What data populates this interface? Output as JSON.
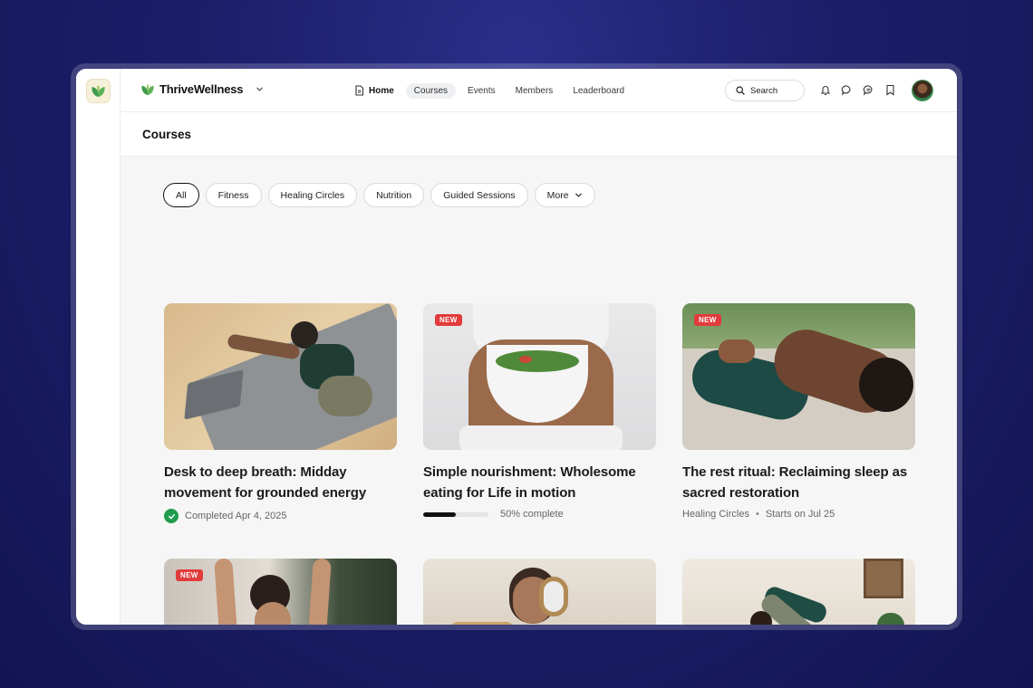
{
  "brand": {
    "name": "ThriveWellness"
  },
  "nav": {
    "home": "Home",
    "courses": "Courses",
    "events": "Events",
    "members": "Members",
    "leaderboard": "Leaderboard"
  },
  "search": {
    "label": "Search"
  },
  "icons": [
    "bell-icon",
    "chat-icon",
    "messages-icon",
    "bookmark-icon"
  ],
  "page": {
    "title": "Courses"
  },
  "filters": [
    "All",
    "Fitness",
    "Healing Circles",
    "Nutrition",
    "Guided Sessions",
    "More"
  ],
  "courses": [
    {
      "title": "Desk to deep breath: Midday movement for grounded energy",
      "status": "Completed Apr 4, 2025",
      "new": false
    },
    {
      "title": "Simple nourishment: Wholesome eating for Life in motion",
      "progress_label": "50% complete",
      "progress": 0.5,
      "new": true,
      "badge": "NEW"
    },
    {
      "title": "The rest ritual: Reclaiming sleep as sacred restoration",
      "category": "Healing Circles",
      "separator": "•",
      "starts": "Starts on Jul 25",
      "new": true,
      "badge": "NEW"
    },
    {
      "new": true,
      "badge": "NEW"
    },
    {
      "new": false
    },
    {
      "new": false
    }
  ],
  "colors": {
    "brand_green": "#3f9a4a",
    "badge_red": "#e23b3b",
    "complete_green": "#1f9d4d"
  }
}
